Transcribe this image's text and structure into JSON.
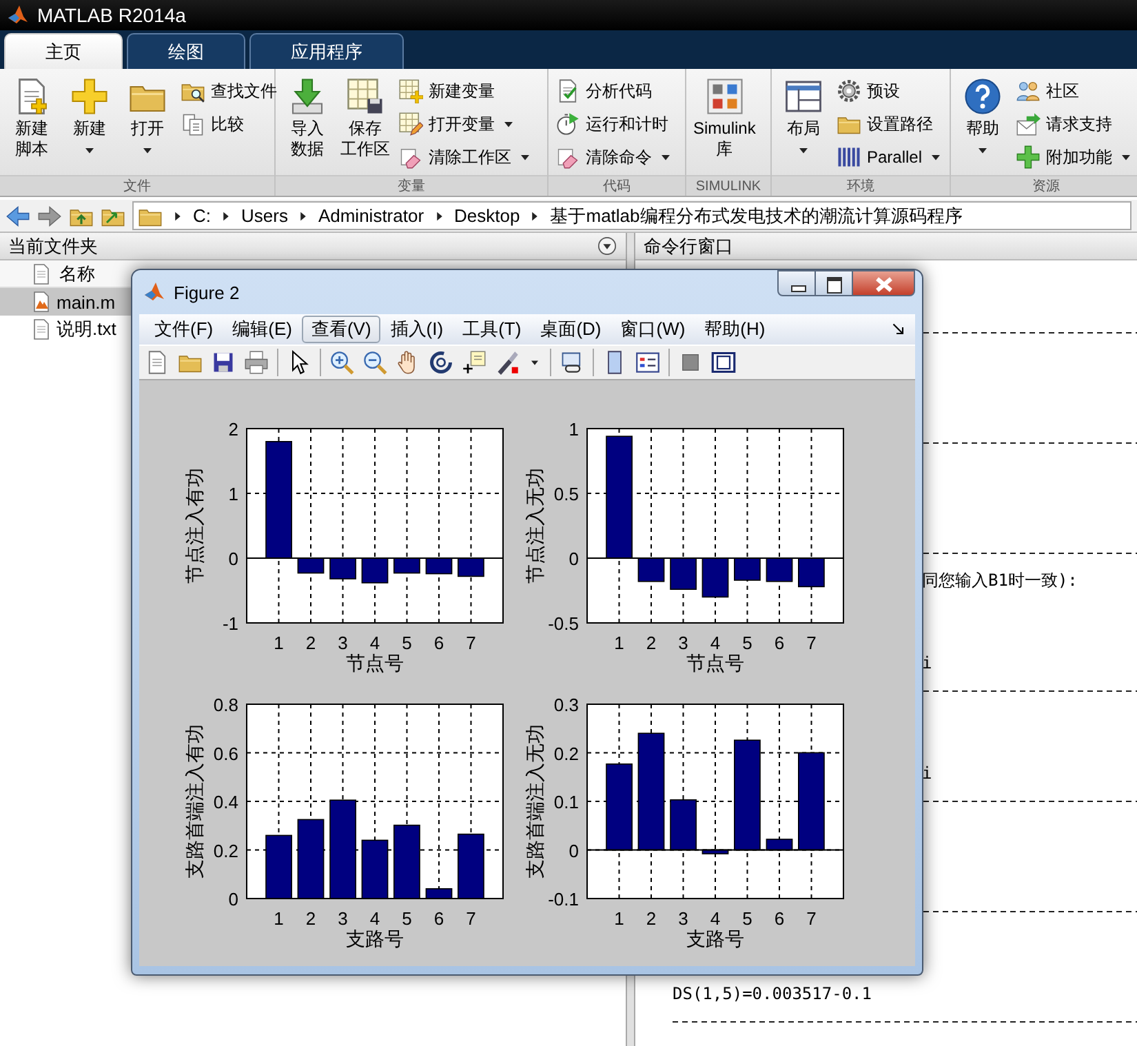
{
  "window": {
    "title": "MATLAB R2014a"
  },
  "tabs": [
    {
      "label": "主页",
      "selected": true
    },
    {
      "label": "绘图",
      "selected": false
    },
    {
      "label": "应用程序",
      "selected": false
    }
  ],
  "ribbon": {
    "groups": [
      {
        "title": "文件",
        "items": [
          {
            "kind": "large",
            "lines": [
              "新建",
              "脚本"
            ],
            "dropdown": false
          },
          {
            "kind": "large",
            "lines": [
              "新建"
            ],
            "dropdown": true
          },
          {
            "kind": "large",
            "lines": [
              "打开"
            ],
            "dropdown": true
          },
          {
            "kind": "small",
            "lines": [
              "查找文件"
            ],
            "dropdown": false
          },
          {
            "kind": "small",
            "lines": [
              "比较"
            ],
            "dropdown": false
          }
        ]
      },
      {
        "title": "变量",
        "items": [
          {
            "kind": "large",
            "lines": [
              "导入",
              "数据"
            ],
            "dropdown": false
          },
          {
            "kind": "large",
            "lines": [
              "保存",
              "工作区"
            ],
            "dropdown": false
          },
          {
            "kind": "small",
            "lines": [
              "新建变量"
            ],
            "dropdown": false
          },
          {
            "kind": "small",
            "lines": [
              "打开变量"
            ],
            "dropdown": true
          },
          {
            "kind": "small",
            "lines": [
              "清除工作区"
            ],
            "dropdown": true
          }
        ]
      },
      {
        "title": "代码",
        "items": [
          {
            "kind": "small",
            "lines": [
              "分析代码"
            ],
            "dropdown": false
          },
          {
            "kind": "small",
            "lines": [
              "运行和计时"
            ],
            "dropdown": false
          },
          {
            "kind": "small",
            "lines": [
              "清除命令"
            ],
            "dropdown": true
          }
        ]
      },
      {
        "title": "SIMULINK",
        "items": [
          {
            "kind": "large",
            "lines": [
              "Simulink",
              "库"
            ],
            "dropdown": false
          }
        ]
      },
      {
        "title": "环境",
        "items": [
          {
            "kind": "large",
            "lines": [
              "布局"
            ],
            "dropdown": true
          },
          {
            "kind": "small",
            "lines": [
              "预设"
            ],
            "dropdown": false
          },
          {
            "kind": "small",
            "lines": [
              "设置路径"
            ],
            "dropdown": false
          },
          {
            "kind": "small",
            "lines": [
              "Parallel"
            ],
            "dropdown": true
          }
        ]
      },
      {
        "title": "资源",
        "items": [
          {
            "kind": "large",
            "lines": [
              "帮助"
            ],
            "dropdown": true
          },
          {
            "kind": "small",
            "lines": [
              "社区"
            ],
            "dropdown": false
          },
          {
            "kind": "small",
            "lines": [
              "请求支持"
            ],
            "dropdown": false
          },
          {
            "kind": "small",
            "lines": [
              "附加功能"
            ],
            "dropdown": true
          }
        ]
      }
    ]
  },
  "address_bar": {
    "segments": [
      "C:",
      "Users",
      "Administrator",
      "Desktop",
      "基于matlab编程分布式发电技术的潮流计算源码程序"
    ]
  },
  "file_browser": {
    "title": "当前文件夹",
    "column": "名称",
    "files": [
      {
        "name": "main.m",
        "kind": "script",
        "selected": true
      },
      {
        "name": "说明.txt",
        "kind": "text",
        "selected": false
      }
    ]
  },
  "command_window": {
    "title": "命令行窗口",
    "lines": [
      {
        "kind": "blank"
      },
      {
        "kind": "blank"
      },
      {
        "kind": "rule"
      },
      {
        "kind": "blank"
      },
      {
        "kind": "blank"
      },
      {
        "kind": "blank"
      },
      {
        "kind": "rule"
      },
      {
        "kind": "blank"
      },
      {
        "kind": "blank"
      },
      {
        "kind": "blank"
      },
      {
        "kind": "rule"
      },
      {
        "kind": "tail",
        "text": "同您输入B1时一致):"
      },
      {
        "kind": "blank"
      },
      {
        "kind": "blank"
      },
      {
        "kind": "tail",
        "text": "i"
      },
      {
        "kind": "rule"
      },
      {
        "kind": "blank"
      },
      {
        "kind": "blank"
      },
      {
        "kind": "tail",
        "text": "i"
      },
      {
        "kind": "rule"
      },
      {
        "kind": "blank"
      },
      {
        "kind": "blank"
      },
      {
        "kind": "blank"
      },
      {
        "kind": "rule"
      },
      {
        "kind": "blank"
      },
      {
        "kind": "blank"
      },
      {
        "kind": "text",
        "text": "DS(1,5)=0.003517-0.1"
      },
      {
        "kind": "rule"
      }
    ]
  },
  "figure": {
    "title": "Figure 2",
    "menu": [
      {
        "label": "文件(F)",
        "selected": false
      },
      {
        "label": "编辑(E)",
        "selected": false
      },
      {
        "label": "查看(V)",
        "selected": true
      },
      {
        "label": "插入(I)",
        "selected": false
      },
      {
        "label": "工具(T)",
        "selected": false
      },
      {
        "label": "桌面(D)",
        "selected": false
      },
      {
        "label": "窗口(W)",
        "selected": false
      },
      {
        "label": "帮助(H)",
        "selected": false
      }
    ],
    "charts": [
      {
        "chart_data": {
          "type": "bar",
          "xlabel": "节点号",
          "ylabel": "节点注入有功",
          "categories": [
            "1",
            "2",
            "3",
            "4",
            "5",
            "6",
            "7"
          ],
          "series": [
            {
              "color": "#000080",
              "values": [
                1.8,
                -0.23,
                -0.32,
                -0.38,
                -0.23,
                -0.24,
                -0.28
              ]
            }
          ],
          "ylim": [
            -1,
            2
          ],
          "yticks": [
            -1,
            0,
            1,
            2
          ],
          "grid": true
        }
      },
      {
        "chart_data": {
          "type": "bar",
          "xlabel": "节点号",
          "ylabel": "节点注入无功",
          "categories": [
            "1",
            "2",
            "3",
            "4",
            "5",
            "6",
            "7"
          ],
          "series": [
            {
              "color": "#000080",
              "values": [
                0.94,
                -0.18,
                -0.24,
                -0.3,
                -0.17,
                -0.18,
                -0.22
              ]
            }
          ],
          "ylim": [
            -0.5,
            1
          ],
          "yticks": [
            -0.5,
            0,
            0.5,
            1
          ],
          "grid": true
        }
      },
      {
        "chart_data": {
          "type": "bar",
          "xlabel": "支路号",
          "ylabel": "支路首端注入有功",
          "categories": [
            "1",
            "2",
            "3",
            "4",
            "5",
            "6",
            "7"
          ],
          "series": [
            {
              "color": "#000080",
              "values": [
                0.26,
                0.325,
                0.405,
                0.24,
                0.302,
                0.04,
                0.265
              ]
            }
          ],
          "ylim": [
            0,
            0.8
          ],
          "yticks": [
            0,
            0.2,
            0.4,
            0.6,
            0.8
          ],
          "grid": true
        }
      },
      {
        "chart_data": {
          "type": "bar",
          "xlabel": "支路号",
          "ylabel": "支路首端注入无功",
          "categories": [
            "1",
            "2",
            "3",
            "4",
            "5",
            "6",
            "7"
          ],
          "series": [
            {
              "color": "#000080",
              "values": [
                0.177,
                0.24,
                0.103,
                -0.008,
                0.226,
                0.022,
                0.2
              ]
            }
          ],
          "ylim": [
            -0.1,
            0.3
          ],
          "yticks": [
            -0.1,
            0,
            0.1,
            0.2,
            0.3
          ],
          "grid": true
        }
      }
    ]
  }
}
